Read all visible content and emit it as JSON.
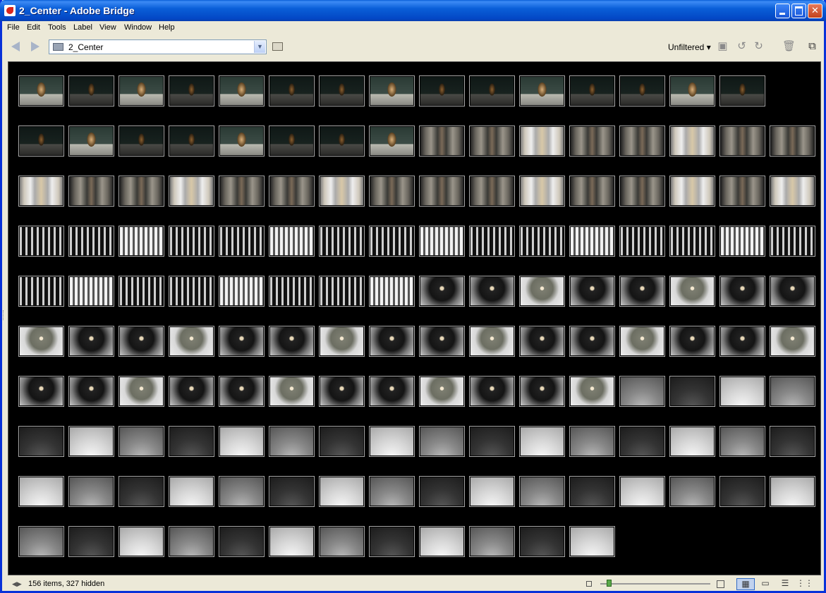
{
  "window": {
    "title": "2_Center - Adobe Bridge"
  },
  "menu": [
    "File",
    "Edit",
    "Tools",
    "Label",
    "View",
    "Window",
    "Help"
  ],
  "toolbar": {
    "path": "2_Center",
    "filter_label": "Unfiltered"
  },
  "status": {
    "text": "156 items, 327 hidden"
  },
  "thumbnail_rows": [
    [
      "elev-b",
      "elev-d",
      "elev-b",
      "elev-d",
      "elev-b",
      "elev-d",
      "elev-d",
      "elev-b",
      "elev-d",
      "elev-d",
      "elev-b",
      "elev-d",
      "elev-d",
      "elev-b",
      "elev-d"
    ],
    [
      "elev-d",
      "elev-b",
      "elev-d",
      "elev-d",
      "elev-b",
      "elev-d",
      "elev-d",
      "elev-b",
      "fres-d",
      "fres-d",
      "fres-b",
      "fres-d",
      "fres-d",
      "fres-b",
      "fres-d",
      "fres-d"
    ],
    [
      "fres-b",
      "fres-d",
      "fres-d",
      "fres-b",
      "fres-d",
      "fres-d",
      "fres-b",
      "fres-d",
      "fres-d",
      "fres-d",
      "fres-b",
      "fres-d",
      "fres-d",
      "fres-b",
      "fres-d",
      "fres-b"
    ],
    [
      "win-d",
      "win-d",
      "win-b",
      "win-d",
      "win-d",
      "win-b",
      "win-d",
      "win-d",
      "win-b",
      "win-d",
      "win-d",
      "win-b",
      "win-d",
      "win-d",
      "win-b",
      "win-d"
    ],
    [
      "win-d",
      "win-b",
      "win-d",
      "win-d",
      "win-b",
      "win-d",
      "win-d",
      "win-b",
      "dome-d",
      "dome-d",
      "dome-b",
      "dome-d",
      "dome-d",
      "dome-b",
      "dome-d",
      "dome-d"
    ],
    [
      "dome-b",
      "dome-d",
      "dome-d",
      "dome-b",
      "dome-d",
      "dome-d",
      "dome-b",
      "dome-d",
      "dome-d",
      "dome-b",
      "dome-d",
      "dome-d",
      "dome-b",
      "dome-d",
      "dome-d",
      "dome-b"
    ],
    [
      "dome-d",
      "dome-d",
      "dome-b",
      "dome-d",
      "dome-d",
      "dome-b",
      "dome-d",
      "dome-d",
      "dome-b",
      "dome-d",
      "dome-d",
      "dome-b",
      "floor-m",
      "floor-d",
      "floor-b",
      "floor-m"
    ],
    [
      "floor-d",
      "floor-b",
      "floor-m",
      "floor-d",
      "floor-b",
      "floor-m",
      "floor-d",
      "floor-b",
      "floor-m",
      "floor-d",
      "floor-b",
      "floor-m",
      "floor-d",
      "floor-b",
      "floor-m",
      "floor-d"
    ],
    [
      "floor-b",
      "floor-m",
      "floor-d",
      "floor-b",
      "floor-m",
      "floor-d",
      "floor-b",
      "floor-m",
      "floor-d",
      "floor-b",
      "floor-m",
      "floor-d",
      "floor-b",
      "floor-m",
      "floor-d",
      "floor-b"
    ],
    [
      "floor-m",
      "floor-d",
      "floor-b",
      "floor-m",
      "floor-d",
      "floor-b",
      "floor-m",
      "floor-d",
      "floor-b",
      "floor-m",
      "floor-d",
      "floor-b"
    ]
  ]
}
